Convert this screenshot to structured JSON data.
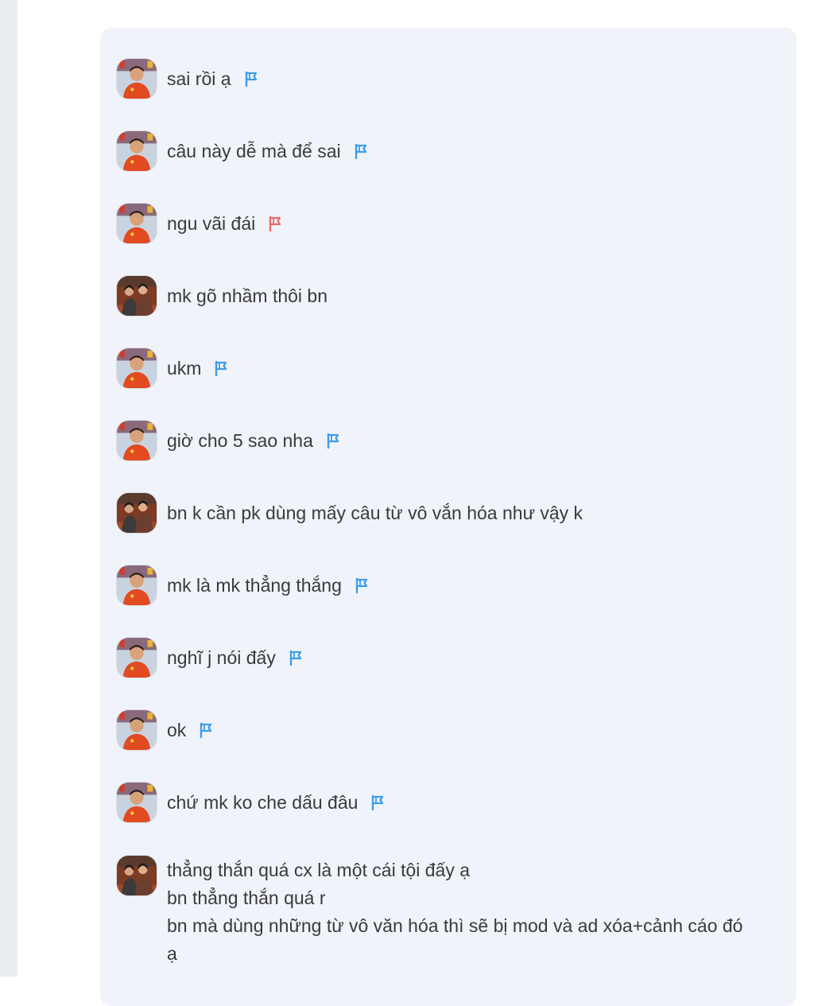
{
  "comments": [
    {
      "text": "sai rồi ạ",
      "avatar": "avatar-orange",
      "flag": "blue"
    },
    {
      "text": "câu này dễ mà  để sai",
      "avatar": "avatar-orange",
      "flag": "blue"
    },
    {
      "text": "ngu vãi đái",
      "avatar": "avatar-orange",
      "flag": "red"
    },
    {
      "text": "mk gõ nhầm thôi bn",
      "avatar": "avatar-group",
      "flag": "none"
    },
    {
      "text": "ukm",
      "avatar": "avatar-orange",
      "flag": "blue"
    },
    {
      "text": "giờ cho 5 sao nha",
      "avatar": "avatar-orange",
      "flag": "blue"
    },
    {
      "text": "bn k cần pk dùng mấy câu từ vô vắn hóa như vậy k",
      "avatar": "avatar-group",
      "flag": "none"
    },
    {
      "text": "mk là mk thẳng thắng",
      "avatar": "avatar-orange",
      "flag": "blue"
    },
    {
      "text": "nghĩ j nói đấy",
      "avatar": "avatar-orange",
      "flag": "blue"
    },
    {
      "text": "ok",
      "avatar": "avatar-orange",
      "flag": "blue"
    },
    {
      "text": "chứ mk ko che dấu đâu",
      "avatar": "avatar-orange",
      "flag": "blue"
    }
  ],
  "last_comment": {
    "avatar": "avatar-group",
    "lines": [
      "thẳng thắn quá cx là một cái tội đấy ạ",
      "bn thẳng thắn quá r",
      "bn mà dùng những từ vô văn hóa thì sẽ bị mod và ad xóa+cảnh cáo đó",
      "ạ"
    ]
  },
  "colors": {
    "panel_bg": "#f0f3f9",
    "flag_blue": "#3d9de8",
    "flag_red": "#e86b6b",
    "text": "#3a3a3a"
  },
  "icons": {
    "flag": "flag-icon",
    "avatar_orange": "avatar-orange-shirt",
    "avatar_group": "avatar-group-photo"
  }
}
